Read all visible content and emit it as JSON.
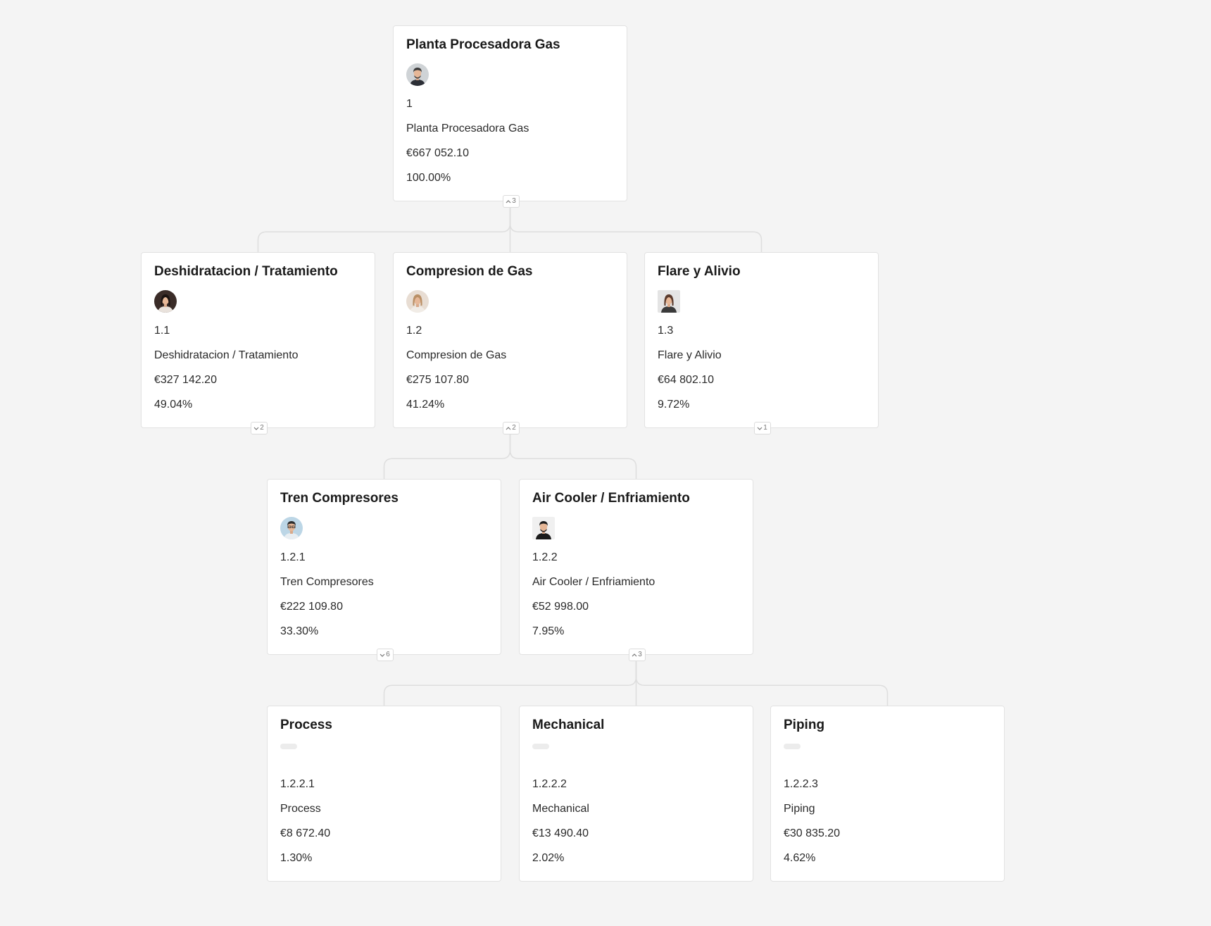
{
  "colors": {
    "background": "#f4f4f4",
    "card": "#ffffff",
    "connector": "#dedede"
  },
  "nodes": [
    {
      "title": "Planta Procesadora Gas",
      "code": "1",
      "name": "Planta Procesadora Gas",
      "amount": "€667 052.10",
      "percent": "100.00%",
      "avatar": "man-dark-suit",
      "toggle_icon": "chevron-up-icon",
      "toggle_count": "3"
    },
    {
      "title": "Deshidratacion / Tratamiento",
      "code": "1.1",
      "name": "Deshidratacion / Tratamiento",
      "amount": "€327 142.20",
      "percent": "49.04%",
      "avatar": "woman-dark-hair",
      "toggle_icon": "chevron-down-icon",
      "toggle_count": "2"
    },
    {
      "title": "Compresion de Gas",
      "code": "1.2",
      "name": "Compresion de Gas",
      "amount": "€275 107.80",
      "percent": "41.24%",
      "avatar": "woman-light-hair",
      "toggle_icon": "chevron-up-icon",
      "toggle_count": "2"
    },
    {
      "title": "Flare y Alivio",
      "code": "1.3",
      "name": "Flare y Alivio",
      "amount": "€64 802.10",
      "percent": "9.72%",
      "avatar": "woman-long-hair",
      "toggle_icon": "chevron-down-icon",
      "toggle_count": "1"
    },
    {
      "title": "Tren Compresores",
      "code": "1.2.1",
      "name": "Tren Compresores",
      "amount": "€222 109.80",
      "percent": "33.30%",
      "avatar": "man-glasses",
      "toggle_icon": "chevron-down-icon",
      "toggle_count": "6"
    },
    {
      "title": "Air Cooler / Enfriamiento",
      "code": "1.2.2",
      "name": "Air Cooler / Enfriamiento",
      "amount": "€52 998.00",
      "percent": "7.95%",
      "avatar": "man-beard",
      "toggle_icon": "chevron-up-icon",
      "toggle_count": "3"
    },
    {
      "title": "Process",
      "code": "1.2.2.1",
      "name": "Process",
      "amount": "€8 672.40",
      "percent": "1.30%",
      "avatar": "",
      "toggle_icon": "",
      "toggle_count": ""
    },
    {
      "title": "Mechanical",
      "code": "1.2.2.2",
      "name": "Mechanical",
      "amount": "€13 490.40",
      "percent": "2.02%",
      "avatar": "",
      "toggle_icon": "",
      "toggle_count": ""
    },
    {
      "title": "Piping",
      "code": "1.2.2.3",
      "name": "Piping",
      "amount": "€30 835.20",
      "percent": "4.62%",
      "avatar": "",
      "toggle_icon": "",
      "toggle_count": ""
    }
  ],
  "edges": [
    [
      "1",
      "1.1"
    ],
    [
      "1",
      "1.2"
    ],
    [
      "1",
      "1.3"
    ],
    [
      "1.2",
      "1.2.1"
    ],
    [
      "1.2",
      "1.2.2"
    ],
    [
      "1.2.2",
      "1.2.2.1"
    ],
    [
      "1.2.2",
      "1.2.2.2"
    ],
    [
      "1.2.2",
      "1.2.2.3"
    ]
  ]
}
